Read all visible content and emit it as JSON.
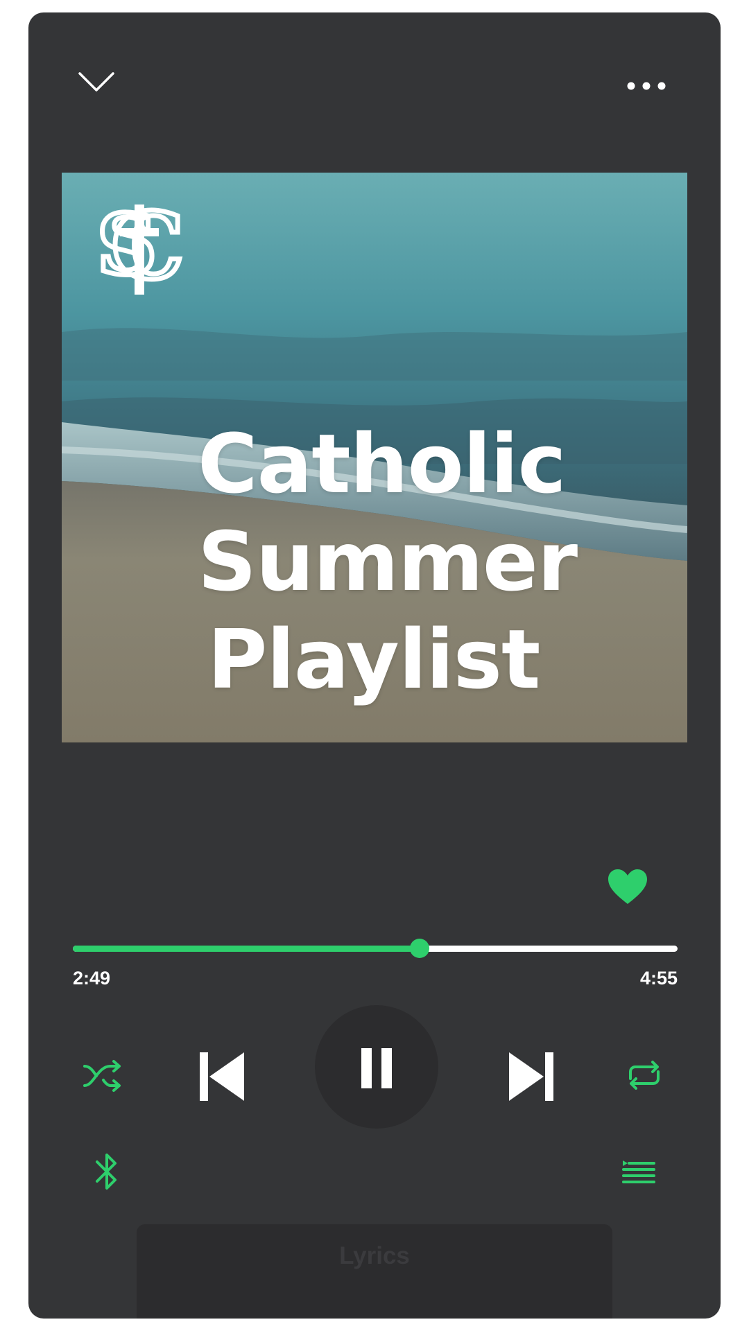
{
  "colors": {
    "background": "#343537",
    "accent": "#2ecf6c",
    "text": "#ffffff",
    "button_dark": "#2c2c2e"
  },
  "header": {
    "collapse_icon": "chevron-down-icon",
    "more_icon": "more-horizontal-icon"
  },
  "cover": {
    "title_lines": [
      "Catholic",
      "Summer",
      "Playlist"
    ],
    "logo_letters": "SC",
    "logo_icon": "cross-monogram-logo"
  },
  "player": {
    "liked": true,
    "elapsed": "2:49",
    "total": "4:55",
    "progress_fraction": 0.573,
    "state": "playing"
  },
  "controls": {
    "shuffle_icon": "shuffle-icon",
    "previous_icon": "skip-previous-icon",
    "pause_icon": "pause-icon",
    "next_icon": "skip-next-icon",
    "repeat_icon": "repeat-icon",
    "bluetooth_icon": "bluetooth-icon",
    "queue_icon": "queue-icon"
  },
  "lyrics": {
    "label": "Lyrics"
  }
}
